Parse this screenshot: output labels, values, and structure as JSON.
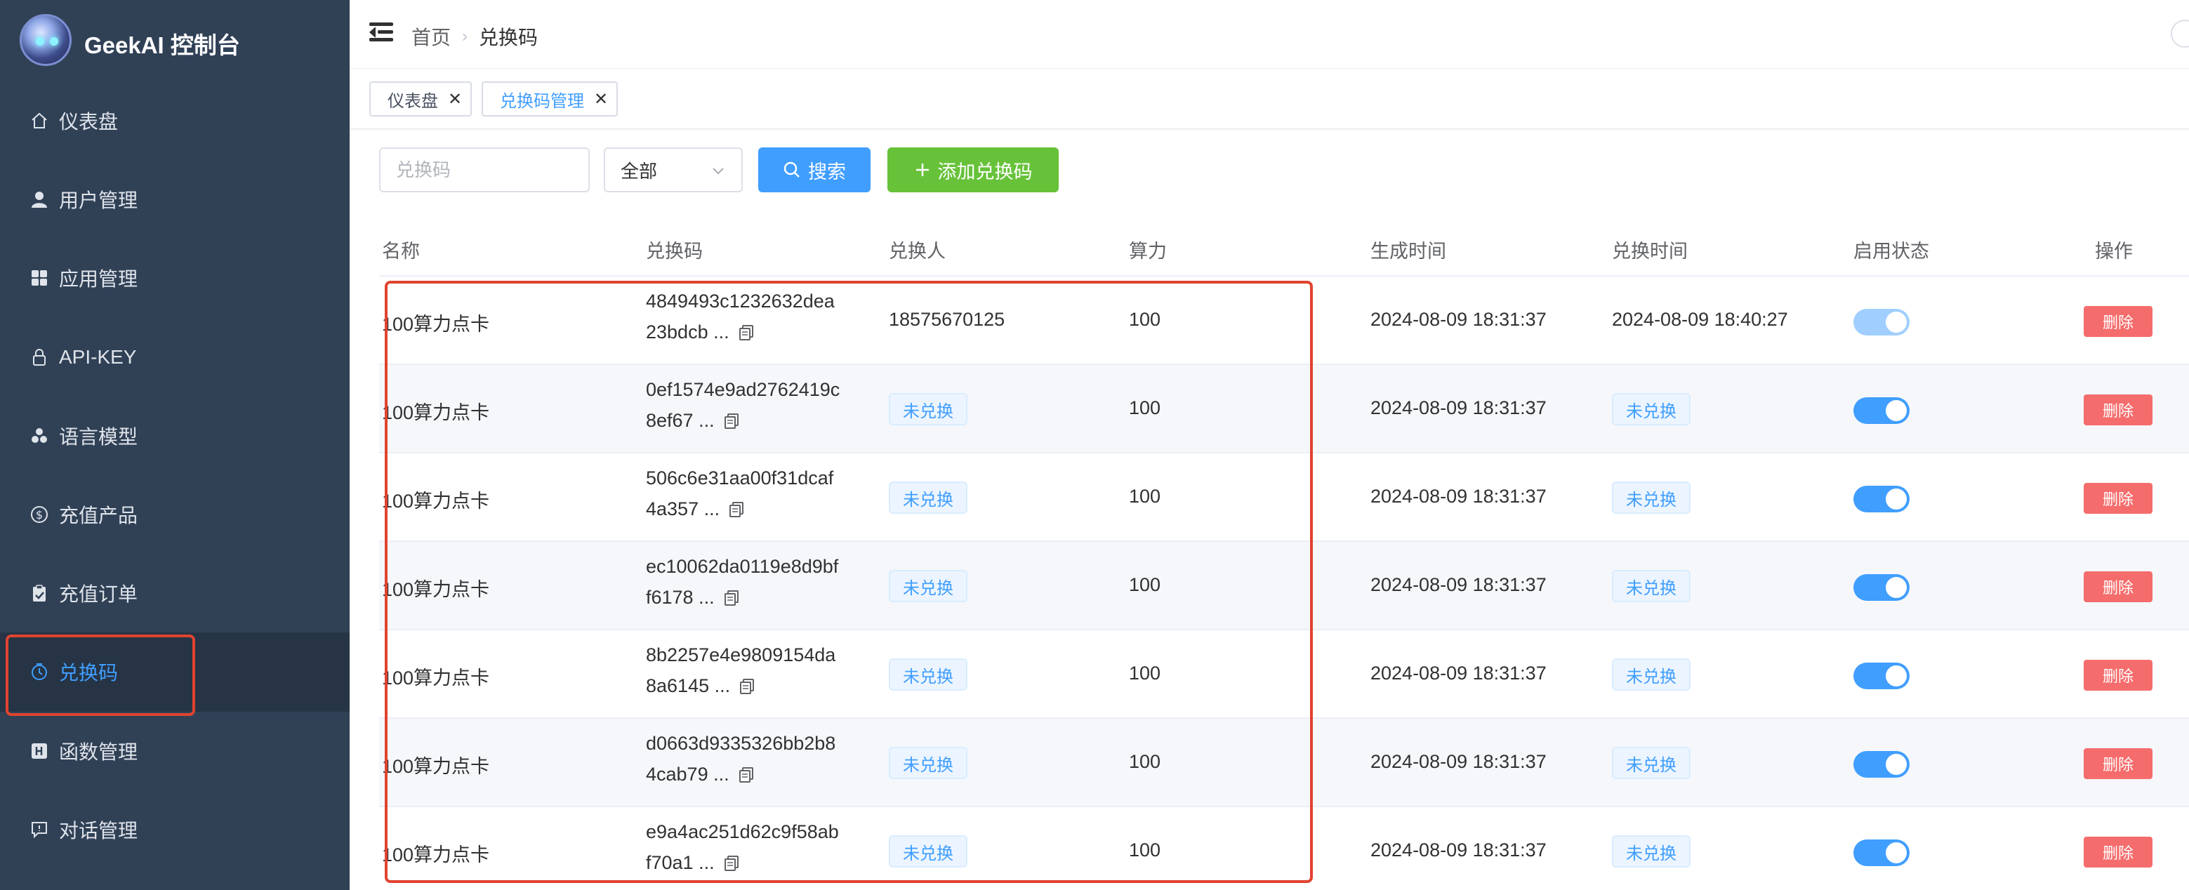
{
  "app": {
    "title": "GeekAI 控制台",
    "colors": {
      "sidebar_bg": "#304156",
      "accent": "#409eff",
      "success": "#67c23a",
      "danger": "#f56c6c",
      "highlight_outline": "#e0432f"
    }
  },
  "sidebar": {
    "items": [
      {
        "label": "仪表盘",
        "icon": "home-icon",
        "active": false
      },
      {
        "label": "用户管理",
        "icon": "user-icon",
        "active": false
      },
      {
        "label": "应用管理",
        "icon": "grid-icon",
        "active": false
      },
      {
        "label": "API-KEY",
        "icon": "lock-icon",
        "active": false
      },
      {
        "label": "语言模型",
        "icon": "cubes-icon",
        "active": false
      },
      {
        "label": "充值产品",
        "icon": "dollar-icon",
        "active": false
      },
      {
        "label": "充值订单",
        "icon": "clipboard-icon",
        "active": false
      },
      {
        "label": "兑换码",
        "icon": "timer-icon",
        "active": true
      },
      {
        "label": "函数管理",
        "icon": "function-icon",
        "active": false
      },
      {
        "label": "对话管理",
        "icon": "chat-icon",
        "active": false
      }
    ]
  },
  "navbar": {
    "breadcrumb": [
      "首页",
      "兑换码"
    ]
  },
  "tags": [
    {
      "label": "仪表盘",
      "active": false
    },
    {
      "label": "兑换码管理",
      "active": true
    }
  ],
  "toolbar": {
    "search_placeholder": "兑换码",
    "select_value": "全部",
    "search_label": "搜索",
    "add_label": "添加兑换码"
  },
  "table": {
    "headers": [
      "名称",
      "兑换码",
      "兑换人",
      "算力",
      "生成时间",
      "兑换时间",
      "启用状态",
      "操作"
    ],
    "delete_label": "删除",
    "rows": [
      {
        "name": "100算力点卡",
        "code_l1": "4849493c1232632dea",
        "code_l2": "23bdcb ...",
        "redeemer": "18575670125",
        "power": "100",
        "created": "2024-08-09 18:31:37",
        "redeemed": "2024-08-09 18:40:27",
        "enabled": true
      },
      {
        "name": "100算力点卡",
        "code_l1": "0ef1574e9ad2762419c",
        "code_l2": "8ef67 ...",
        "redeemer": "未兑换",
        "power": "100",
        "created": "2024-08-09 18:31:37",
        "redeemed": "未兑换",
        "enabled": true
      },
      {
        "name": "100算力点卡",
        "code_l1": "506c6e31aa00f31dcaf",
        "code_l2": "4a357 ...",
        "redeemer": "未兑换",
        "power": "100",
        "created": "2024-08-09 18:31:37",
        "redeemed": "未兑换",
        "enabled": true
      },
      {
        "name": "100算力点卡",
        "code_l1": "ec10062da0119e8d9bf",
        "code_l2": "f6178 ...",
        "redeemer": "未兑换",
        "power": "100",
        "created": "2024-08-09 18:31:37",
        "redeemed": "未兑换",
        "enabled": true
      },
      {
        "name": "100算力点卡",
        "code_l1": "8b2257e4e9809154da",
        "code_l2": "8a6145 ...",
        "redeemer": "未兑换",
        "power": "100",
        "created": "2024-08-09 18:31:37",
        "redeemed": "未兑换",
        "enabled": true
      },
      {
        "name": "100算力点卡",
        "code_l1": "d0663d9335326bb2b8",
        "code_l2": "4cab79 ...",
        "redeemer": "未兑换",
        "power": "100",
        "created": "2024-08-09 18:31:37",
        "redeemed": "未兑换",
        "enabled": true
      },
      {
        "name": "100算力点卡",
        "code_l1": "e9a4ac251d62c9f58ab",
        "code_l2": "f70a1 ...",
        "redeemer": "未兑换",
        "power": "100",
        "created": "2024-08-09 18:31:37",
        "redeemed": "未兑换",
        "enabled": true
      }
    ]
  }
}
